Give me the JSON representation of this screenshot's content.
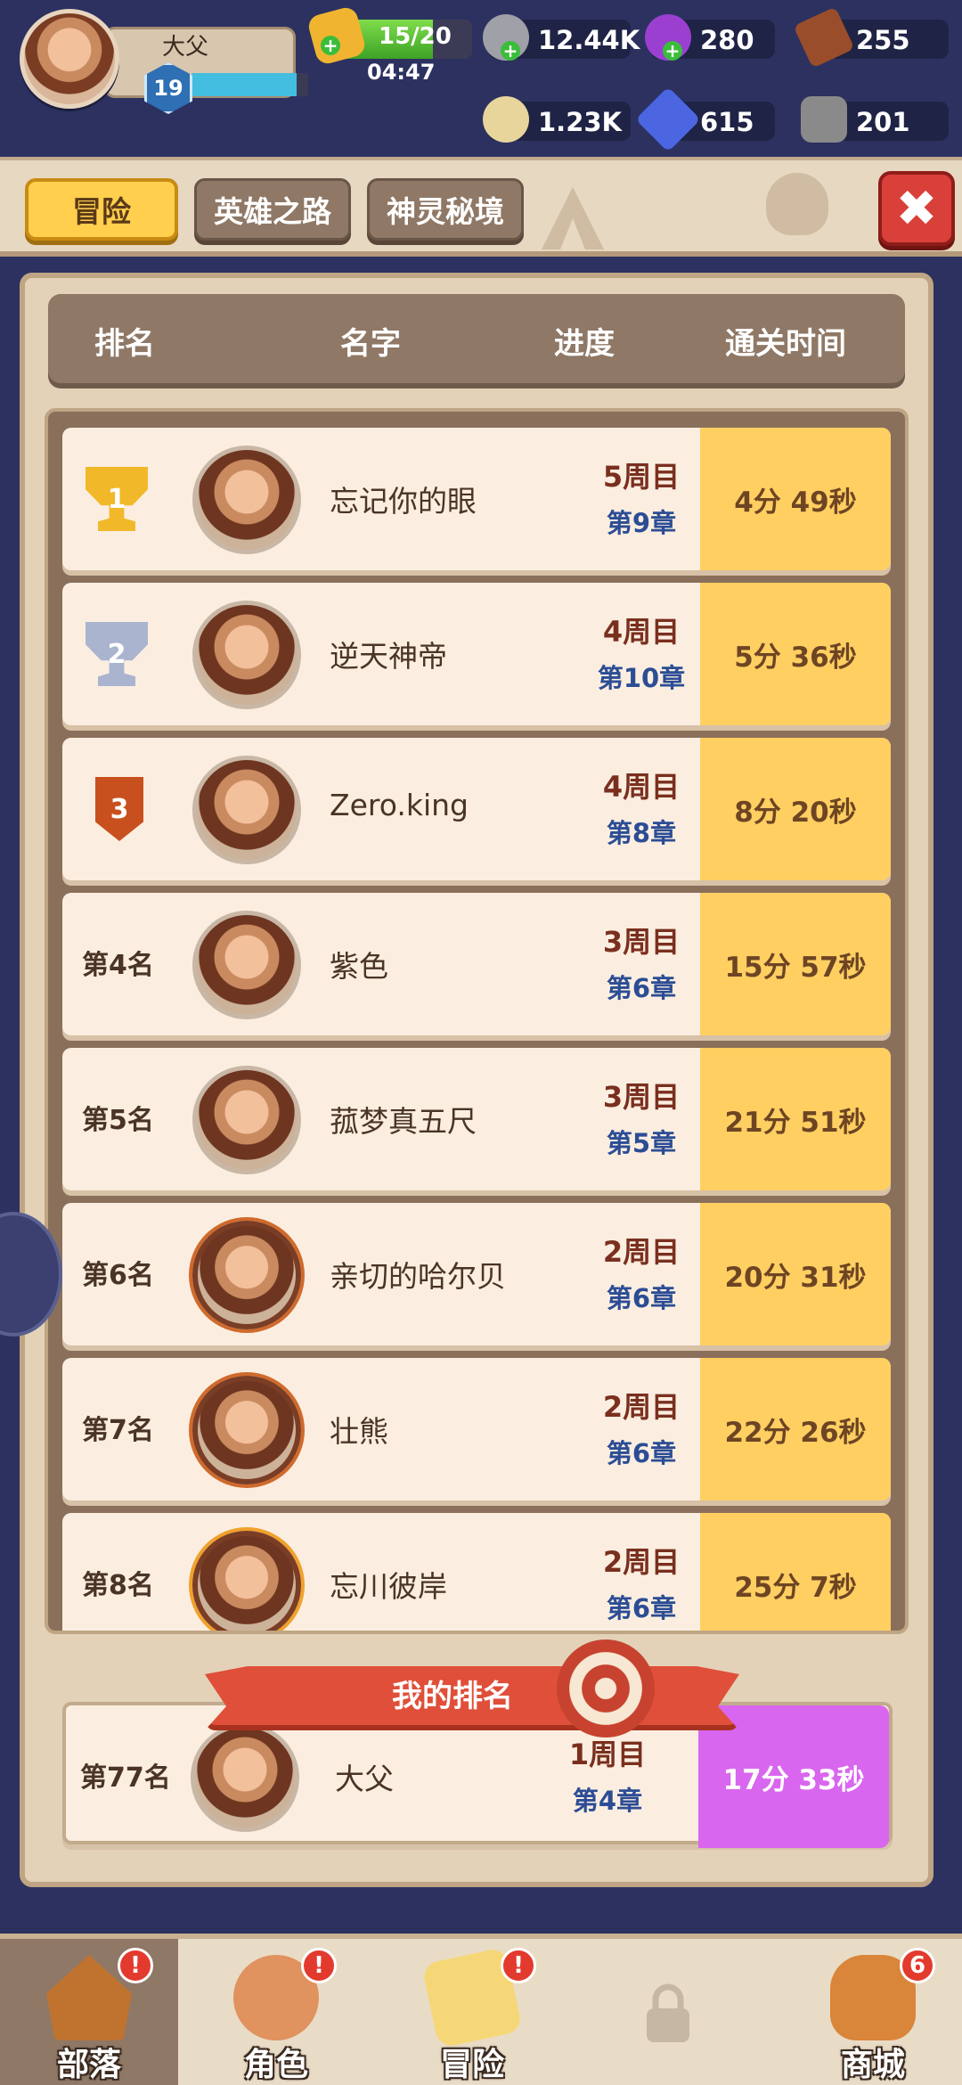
{
  "player": {
    "name": "大父",
    "level": "19",
    "xp_progress": 0.9
  },
  "resources": {
    "stamina": "15/20",
    "stamina_progress": 0.75,
    "stamina_timer": "04:47",
    "coins": "12.44K",
    "purple_gem": "280",
    "wood": "255",
    "gold_ore": "1.23K",
    "diamond": "615",
    "stone": "201"
  },
  "tabs": [
    {
      "label": "冒险",
      "active": true
    },
    {
      "label": "英雄之路",
      "active": false
    },
    {
      "label": "神灵秘境",
      "active": false
    }
  ],
  "header": {
    "rank": "排名",
    "name": "名字",
    "progress": "进度",
    "time": "通关时间"
  },
  "rows": [
    {
      "rank": "1",
      "trophy": "gold",
      "name": "忘记你的眼",
      "cycle": "5周目",
      "chapter": "第9章",
      "time": "4分 49秒"
    },
    {
      "rank": "2",
      "trophy": "silver",
      "name": "逆天神帝",
      "cycle": "4周目",
      "chapter": "第10章",
      "time": "5分 36秒"
    },
    {
      "rank": "3",
      "trophy": "bronze",
      "name": "Zero.king",
      "cycle": "4周目",
      "chapter": "第8章",
      "time": "8分 20秒"
    },
    {
      "rank": "第4名",
      "trophy": "",
      "name": "紫色",
      "cycle": "3周目",
      "chapter": "第6章",
      "time": "15分 57秒"
    },
    {
      "rank": "第5名",
      "trophy": "",
      "name": "菰梦真五尺",
      "cycle": "3周目",
      "chapter": "第5章",
      "time": "21分 51秒"
    },
    {
      "rank": "第6名",
      "trophy": "",
      "name": "亲切的哈尔贝",
      "cycle": "2周目",
      "chapter": "第6章",
      "time": "20分 31秒"
    },
    {
      "rank": "第7名",
      "trophy": "",
      "name": "壮熊",
      "cycle": "2周目",
      "chapter": "第6章",
      "time": "22分 26秒"
    },
    {
      "rank": "第8名",
      "trophy": "",
      "name": "忘川彼岸",
      "cycle": "2周目",
      "chapter": "第6章",
      "time": "25分 7秒"
    }
  ],
  "my_rank": {
    "title": "我的排名",
    "rank": "第77名",
    "name": "大父",
    "cycle": "1周目",
    "chapter": "第4章",
    "time": "17分 33秒"
  },
  "nav": [
    {
      "label": "部落",
      "alert": "!"
    },
    {
      "label": "角色",
      "alert": "!"
    },
    {
      "label": "冒险",
      "alert": "!"
    },
    {
      "label": "",
      "locked": true
    },
    {
      "label": "商城",
      "badge": "6"
    }
  ],
  "colors": {
    "background": "#2c3160",
    "time_cell": "#ffcf62",
    "my_time_cell": "#d966ee",
    "active_tab": "#ffcf4d",
    "close_button": "#d9403a"
  }
}
